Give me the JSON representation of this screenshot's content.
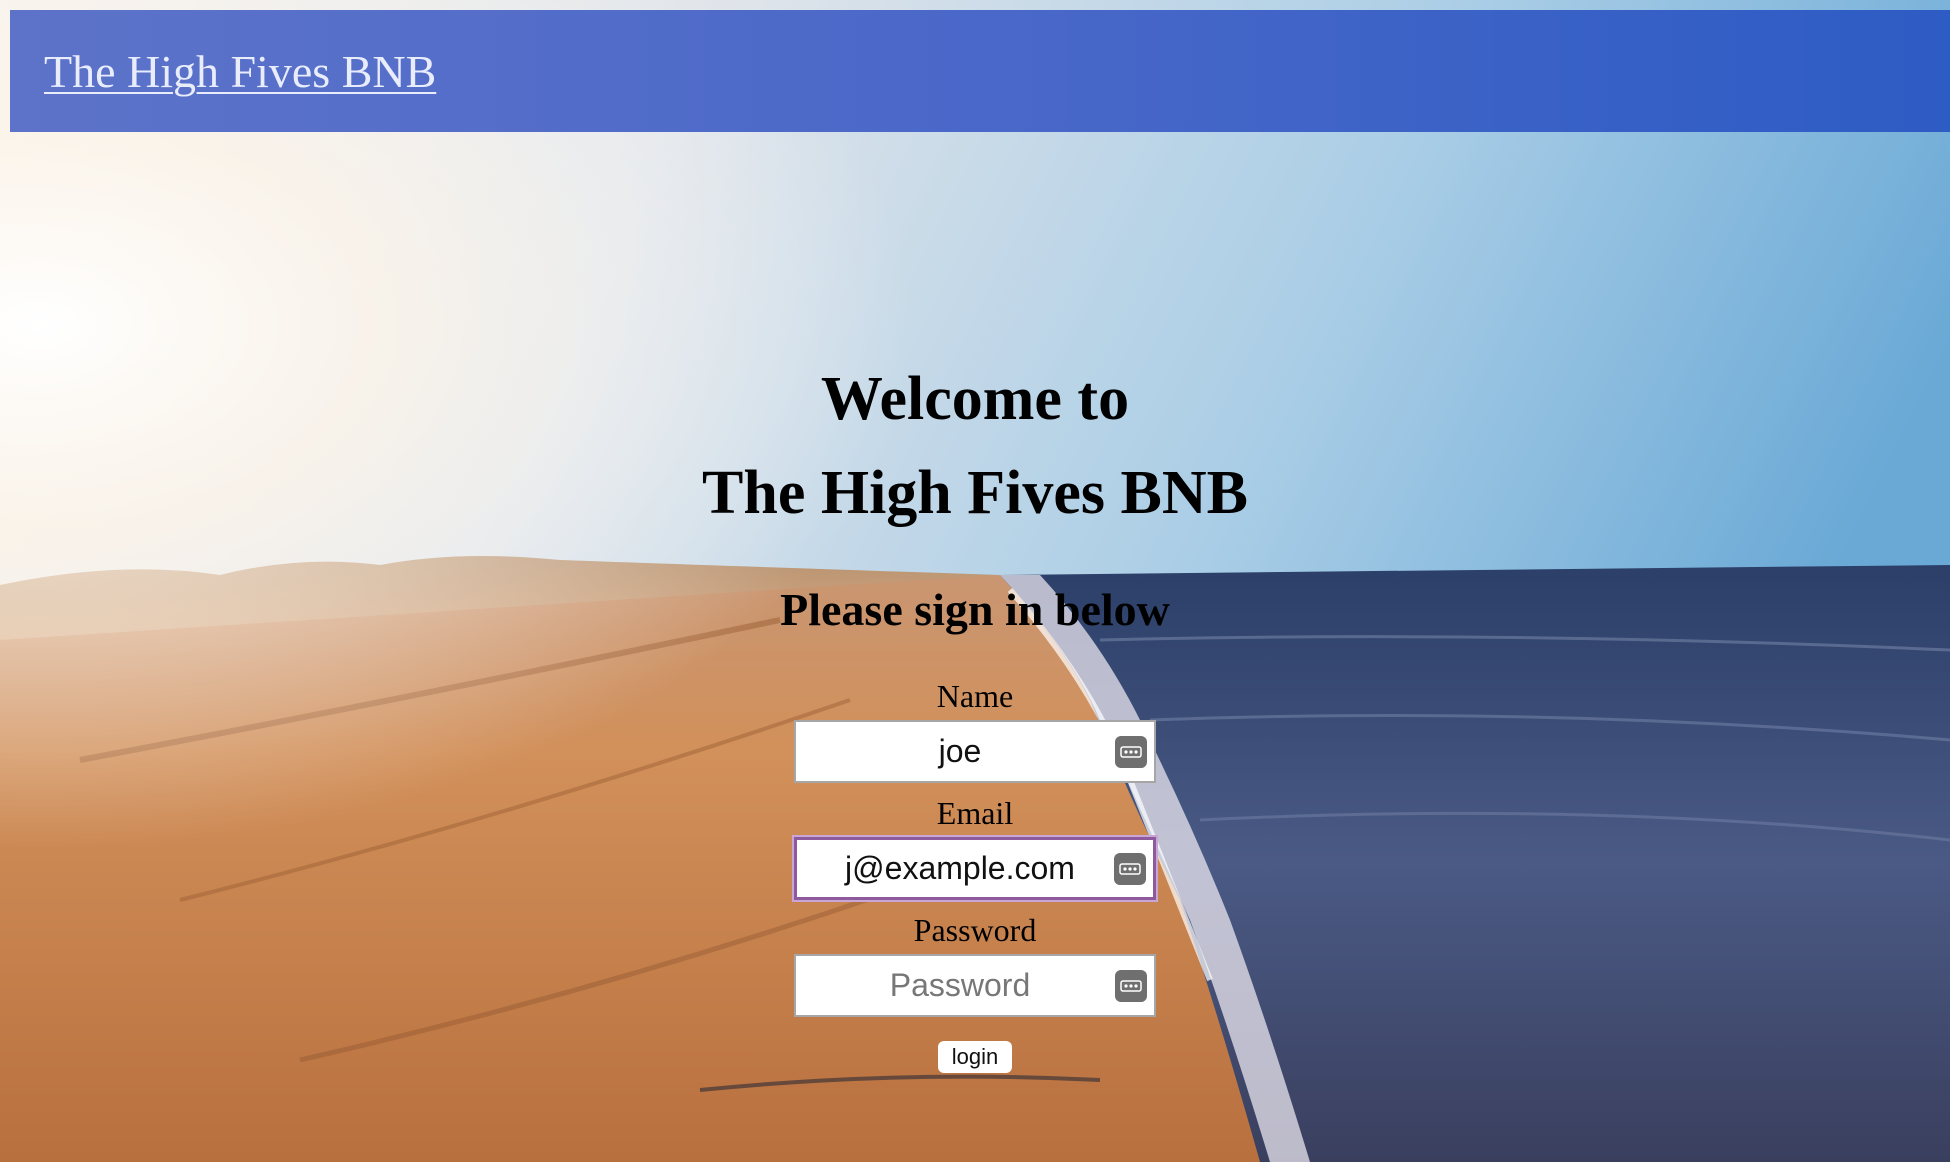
{
  "navbar": {
    "brand": "The High Fives BNB",
    "color": "#5570c9"
  },
  "hero": {
    "welcome_line1": "Welcome to",
    "welcome_line2": "The High Fives BNB",
    "subtitle": "Please sign in below"
  },
  "form": {
    "name": {
      "label": "Name",
      "value": "joe",
      "icon": "autofill-key-icon"
    },
    "email": {
      "label": "Email",
      "value": "j@example.com",
      "icon": "autofill-key-icon"
    },
    "password": {
      "label": "Password",
      "placeholder": "Password",
      "value": "",
      "icon": "autofill-key-icon"
    },
    "login_label": "login"
  },
  "colors": {
    "focus_ring": "#8d5a9e"
  }
}
